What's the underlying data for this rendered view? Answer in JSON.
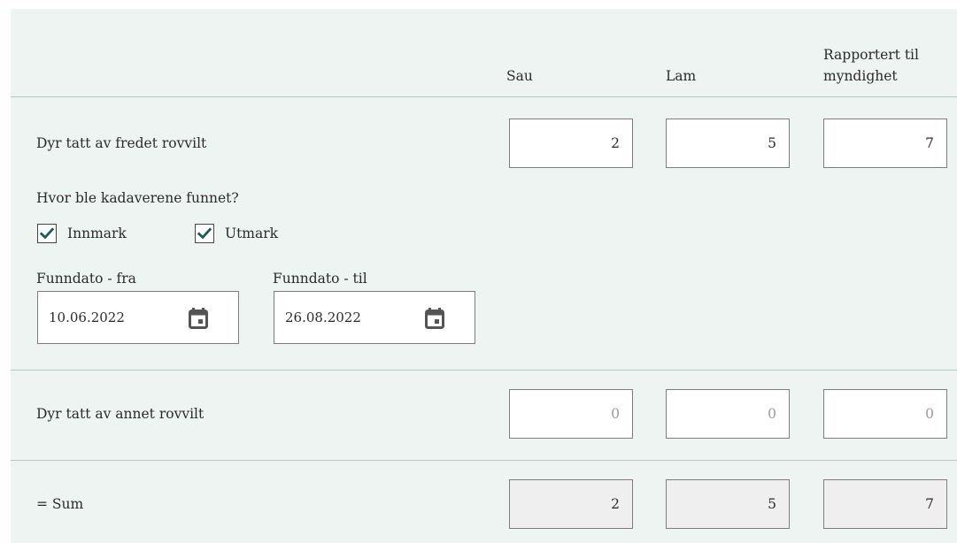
{
  "columns": {
    "sau": "Sau",
    "lam": "Lam",
    "rapportert_line1": "Rapportert til",
    "rapportert_line2": "myndighet"
  },
  "row_fredet": {
    "label": "Dyr tatt av fredet rovvilt",
    "sau": "2",
    "lam": "5",
    "rapportert": "7"
  },
  "location": {
    "question": "Hvor ble kadaverene funnet?",
    "options": [
      {
        "label": "Innmark",
        "checked": true
      },
      {
        "label": "Utmark",
        "checked": true
      }
    ]
  },
  "dates": {
    "from_label": "Funndato - fra",
    "from_value": "10.06.2022",
    "to_label": "Funndato - til",
    "to_value": "26.08.2022"
  },
  "row_annet": {
    "label": "Dyr tatt av annet rovvilt",
    "sau_placeholder": "0",
    "lam_placeholder": "0",
    "rapportert_placeholder": "0"
  },
  "row_sum": {
    "label": "= Sum",
    "sau": "2",
    "lam": "5",
    "rapportert": "7"
  },
  "colors": {
    "panel_bg": "#eef4f2",
    "divider": "#b5c8c3",
    "check": "#1e5a55"
  },
  "icons": {
    "checkbox": "check-icon",
    "date_picker": "calendar-icon"
  }
}
